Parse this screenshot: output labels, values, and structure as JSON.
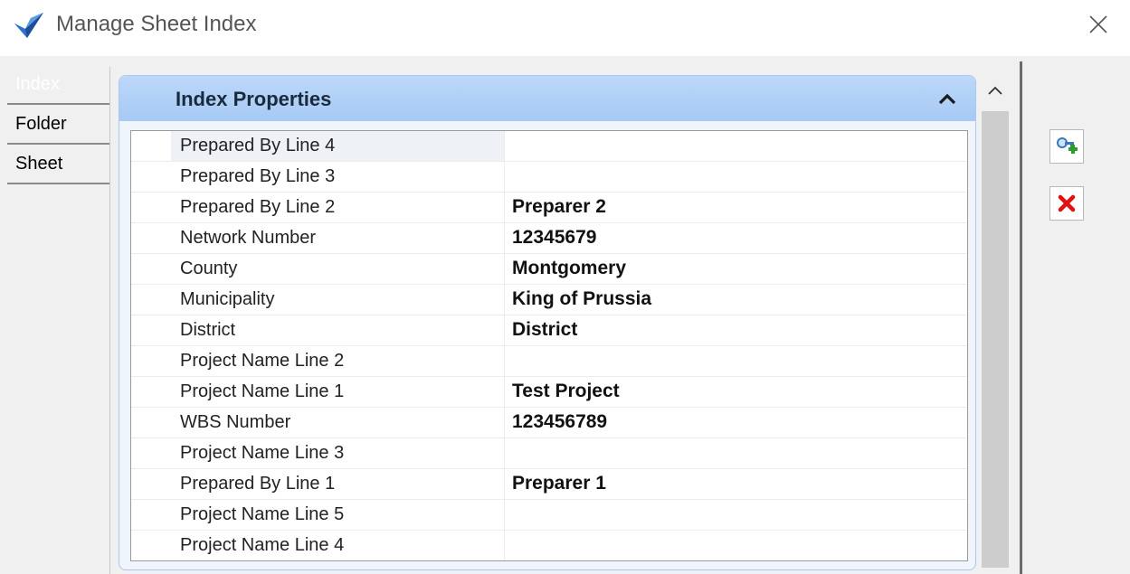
{
  "window": {
    "title": "Manage Sheet Index"
  },
  "tabs": [
    {
      "label": "Index",
      "active": true
    },
    {
      "label": "Folder",
      "active": false
    },
    {
      "label": "Sheet",
      "active": false
    }
  ],
  "panel": {
    "title": "Index Properties",
    "properties": [
      {
        "name": "Prepared By Line 4",
        "value": ""
      },
      {
        "name": "Prepared By Line 3",
        "value": ""
      },
      {
        "name": "Prepared By Line 2",
        "value": "Preparer 2"
      },
      {
        "name": "Network Number",
        "value": "12345679"
      },
      {
        "name": "County",
        "value": "Montgomery"
      },
      {
        "name": "Municipality",
        "value": "King of Prussia"
      },
      {
        "name": "District",
        "value": "District"
      },
      {
        "name": "Project Name Line 2",
        "value": ""
      },
      {
        "name": "Project Name Line 1",
        "value": "Test Project"
      },
      {
        "name": "WBS Number",
        "value": "123456789"
      },
      {
        "name": "Project Name Line 3",
        "value": ""
      },
      {
        "name": "Prepared By Line 1",
        "value": "Preparer 1"
      },
      {
        "name": "Project Name Line 5",
        "value": ""
      },
      {
        "name": "Project Name Line 4",
        "value": ""
      }
    ]
  },
  "icons": {
    "app": "sheet-index-app-icon",
    "close": "close-icon",
    "collapse": "chevron-up-icon",
    "scroll_up": "scroll-up-arrow-icon",
    "add": "add-key-icon",
    "delete": "delete-x-icon"
  },
  "colors": {
    "header": "#a7c9f4",
    "delete": "#e01010",
    "add": "#2aa02a"
  }
}
